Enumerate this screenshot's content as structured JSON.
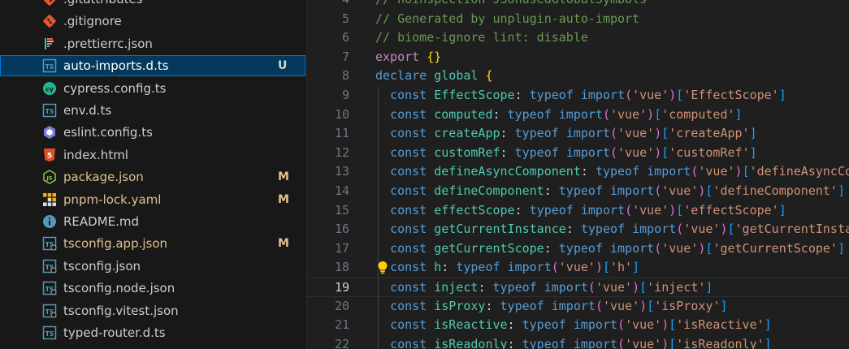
{
  "explorer": {
    "files": [
      {
        "name": ".gitattributes",
        "icon": "git-icon",
        "status": "",
        "selected": false
      },
      {
        "name": ".gitignore",
        "icon": "git-icon",
        "status": "",
        "selected": false
      },
      {
        "name": ".prettierrc.json",
        "icon": "prettier-icon",
        "status": "",
        "selected": false
      },
      {
        "name": "auto-imports.d.ts",
        "icon": "typescript-definition-icon",
        "status": "U",
        "selected": true
      },
      {
        "name": "cypress.config.ts",
        "icon": "cypress-icon",
        "status": "",
        "selected": false
      },
      {
        "name": "env.d.ts",
        "icon": "typescript-definition-icon",
        "status": "",
        "selected": false
      },
      {
        "name": "eslint.config.ts",
        "icon": "eslint-icon",
        "status": "",
        "selected": false
      },
      {
        "name": "index.html",
        "icon": "html-icon",
        "status": "",
        "selected": false
      },
      {
        "name": "package.json",
        "icon": "nodejs-icon",
        "status": "M",
        "selected": false
      },
      {
        "name": "pnpm-lock.yaml",
        "icon": "pnpm-icon",
        "status": "M",
        "selected": false
      },
      {
        "name": "README.md",
        "icon": "info-icon",
        "status": "",
        "selected": false
      },
      {
        "name": "tsconfig.app.json",
        "icon": "tsconfig-icon",
        "status": "M",
        "selected": false
      },
      {
        "name": "tsconfig.json",
        "icon": "tsconfig-icon",
        "status": "",
        "selected": false
      },
      {
        "name": "tsconfig.node.json",
        "icon": "tsconfig-icon",
        "status": "",
        "selected": false
      },
      {
        "name": "tsconfig.vitest.json",
        "icon": "tsconfig-icon",
        "status": "",
        "selected": false
      },
      {
        "name": "typed-router.d.ts",
        "icon": "typescript-definition-icon",
        "status": "",
        "selected": false
      }
    ]
  },
  "editor": {
    "current_line": 19,
    "lightbulb_line": 18,
    "lines": [
      {
        "n": "4",
        "kind": "comment",
        "text": "// noinspection JSUnusedGlobalSymbols"
      },
      {
        "n": "5",
        "kind": "comment",
        "text": "// Generated by unplugin-auto-import"
      },
      {
        "n": "6",
        "kind": "comment",
        "text": "// biome-ignore lint: disable"
      },
      {
        "n": "7",
        "kind": "export",
        "text": "export {}"
      },
      {
        "n": "8",
        "kind": "declare",
        "text": "declare global {"
      },
      {
        "n": "9",
        "kind": "const",
        "name": "EffectScope",
        "key": "EffectScope"
      },
      {
        "n": "10",
        "kind": "const",
        "name": "computed",
        "key": "computed"
      },
      {
        "n": "11",
        "kind": "const",
        "name": "createApp",
        "key": "createApp"
      },
      {
        "n": "12",
        "kind": "const",
        "name": "customRef",
        "key": "customRef"
      },
      {
        "n": "13",
        "kind": "const",
        "name": "defineAsyncComponent",
        "key": "defineAsyncComponent"
      },
      {
        "n": "14",
        "kind": "const",
        "name": "defineComponent",
        "key": "defineComponent"
      },
      {
        "n": "15",
        "kind": "const",
        "name": "effectScope",
        "key": "effectScope"
      },
      {
        "n": "16",
        "kind": "const",
        "name": "getCurrentInstance",
        "key": "getCurrentInstance"
      },
      {
        "n": "17",
        "kind": "const",
        "name": "getCurrentScope",
        "key": "getCurrentScope"
      },
      {
        "n": "18",
        "kind": "const",
        "name": "h",
        "key": "h"
      },
      {
        "n": "19",
        "kind": "const",
        "name": "inject",
        "key": "inject"
      },
      {
        "n": "20",
        "kind": "const",
        "name": "isProxy",
        "key": "isProxy"
      },
      {
        "n": "21",
        "kind": "const",
        "name": "isReactive",
        "key": "isReactive"
      },
      {
        "n": "22",
        "kind": "const",
        "name": "isReadonly",
        "key": "isReadonly"
      }
    ]
  }
}
